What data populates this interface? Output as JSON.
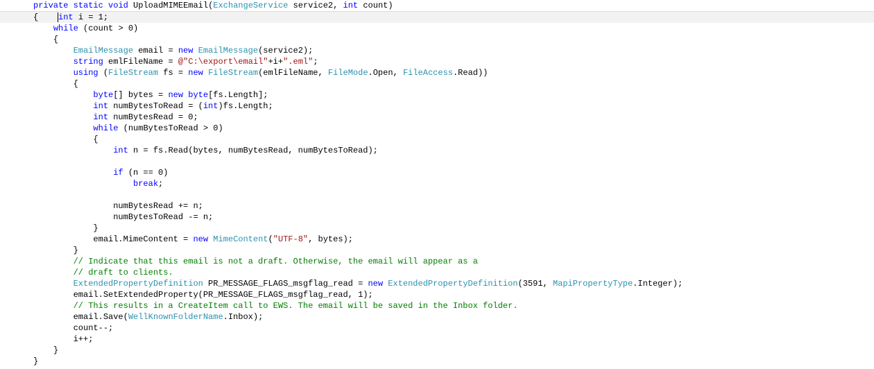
{
  "code": {
    "l1": {
      "a": "private",
      "b": "static",
      "c": "void",
      "d": " UploadMIMEEmail(",
      "e": "ExchangeService",
      "f": " service2, ",
      "g": "int",
      "h": " count)"
    },
    "l2": "{    ",
    "l2b": "int",
    "l2c": " i = 1;",
    "l3a": "while",
    "l3b": " (count > 0)",
    "l4": "{",
    "l5": {
      "a": "EmailMessage",
      "b": " email = ",
      "c": "new",
      "d": " ",
      "e": "EmailMessage",
      "f": "(service2);"
    },
    "l6": {
      "a": "string",
      "b": " emlFileName = ",
      "c": "@\"C:\\export\\email\"",
      "d": "+i+",
      "e": "\".eml\"",
      "f": ";"
    },
    "l7": {
      "a": "using",
      "b": " (",
      "c": "FileStream",
      "d": " fs = ",
      "e": "new",
      "f": " ",
      "g": "FileStream",
      "h": "(emlFileName, ",
      "i": "FileMode",
      "j": ".Open, ",
      "k": "FileAccess",
      "l": ".Read))"
    },
    "l8": "{",
    "l9": {
      "a": "byte",
      "b": "[] bytes = ",
      "c": "new",
      "d": " ",
      "e": "byte",
      "f": "[fs.Length];"
    },
    "l10": {
      "a": "int",
      "b": " numBytesToRead = (",
      "c": "int",
      "d": ")fs.Length;"
    },
    "l11": {
      "a": "int",
      "b": " numBytesRead = 0;"
    },
    "l12": {
      "a": "while",
      "b": " (numBytesToRead > 0)"
    },
    "l13": "{",
    "l14": {
      "a": "int",
      "b": " n = fs.Read(bytes, numBytesRead, numBytesToRead);"
    },
    "l15": {
      "a": "if",
      "b": " (n == 0)"
    },
    "l16": {
      "a": "break",
      "b": ";"
    },
    "l17": "numBytesRead += n;",
    "l18": "numBytesToRead -= n;",
    "l19": "}",
    "l20": {
      "a": "email.MimeContent = ",
      "b": "new",
      "c": " ",
      "d": "MimeContent",
      "e": "(",
      "f": "\"UTF-8\"",
      "g": ", bytes);"
    },
    "l21": "}",
    "c1": "// Indicate that this email is not a draft. Otherwise, the email will appear as a ",
    "c2": "// draft to clients.",
    "l22": {
      "a": "ExtendedPropertyDefinition",
      "b": " PR_MESSAGE_FLAGS_msgflag_read = ",
      "c": "new",
      "d": " ",
      "e": "ExtendedPropertyDefinition",
      "f": "(3591, ",
      "g": "MapiPropertyType",
      "h": ".Integer);"
    },
    "l23": "email.SetExtendedProperty(PR_MESSAGE_FLAGS_msgflag_read, 1);",
    "c3": "// This results in a CreateItem call to EWS. The email will be saved in the Inbox folder.",
    "l24": {
      "a": "email.Save(",
      "b": "WellKnownFolderName",
      "c": ".Inbox);"
    },
    "l25": "count--;",
    "l26": "i++;",
    "l27": "}",
    "l28": "}"
  },
  "indent": {
    "i0": "",
    "i1": "    ",
    "i2": "        ",
    "i3": "            ",
    "i4": "                ",
    "i5": "                    "
  }
}
